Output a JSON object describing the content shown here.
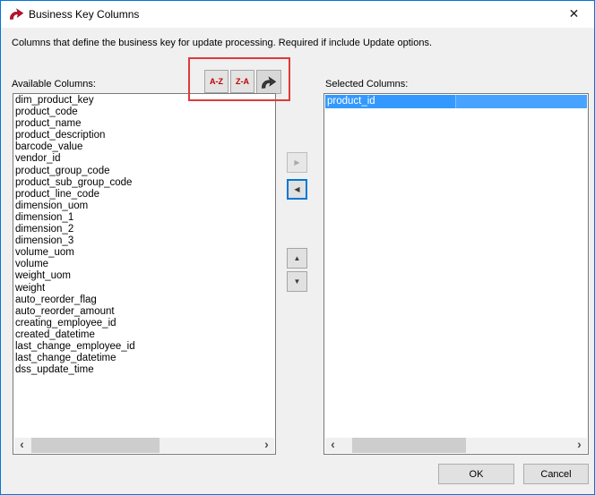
{
  "window": {
    "title": "Business Key Columns",
    "description": "Columns that define the business key for update processing. Required if include Update options."
  },
  "icons": {
    "app_icon": "wherescape-red-swoosh",
    "close": "✕",
    "sort_original_icon": "wherescape-swoosh",
    "move_right": "▶",
    "move_left": "◀",
    "move_up": "▲",
    "move_down": "▼",
    "scroll_left": "‹",
    "scroll_right": "›"
  },
  "toolbar": {
    "az_label": "A-Z",
    "za_label": "Z-A"
  },
  "available": {
    "label": "Available Columns:",
    "items": [
      "dim_product_key",
      "product_code",
      "product_name",
      "product_description",
      "barcode_value",
      "vendor_id",
      "product_group_code",
      "product_sub_group_code",
      "product_line_code",
      "dimension_uom",
      "dimension_1",
      "dimension_2",
      "dimension_3",
      "volume_uom",
      "volume",
      "weight_uom",
      "weight",
      "auto_reorder_flag",
      "auto_reorder_amount",
      "creating_employee_id",
      "created_datetime",
      "last_change_employee_id",
      "last_change_datetime",
      "dss_update_time"
    ]
  },
  "selected": {
    "label": "Selected Columns:",
    "items": [
      "product_id"
    ]
  },
  "actions": {
    "ok": "OK",
    "cancel": "Cancel"
  },
  "colors": {
    "accent_border": "#0078d7",
    "selection_blue": "#3399ff",
    "annotation_red": "#e03a3a",
    "sort_text_red": "#c00000"
  }
}
